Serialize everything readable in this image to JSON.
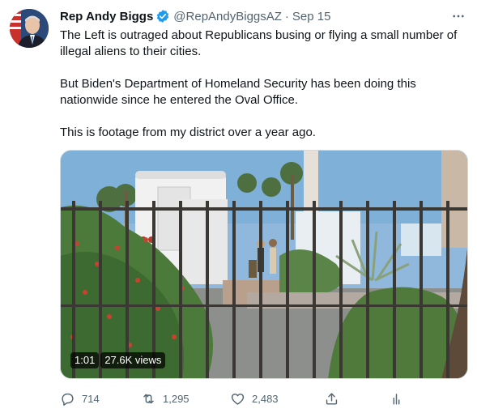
{
  "tweet": {
    "display_name": "Rep Andy Biggs",
    "verified": true,
    "handle": "@RepAndyBiggsAZ",
    "separator": "·",
    "date": "Sep 15",
    "text": [
      "The Left is outraged about Republicans busing or flying a small number of illegal aliens to their cities.",
      "But Biden's Department of Homeland Security has been doing this nationwide since he entered the Oval Office.",
      "This is footage from my district over a year ago."
    ],
    "media": {
      "duration": "1:01",
      "views": "27.6K views"
    },
    "actions": {
      "replies": "714",
      "retweets": "1,295",
      "likes": "2,483"
    }
  },
  "icons": {
    "more": "more-icon",
    "verified": "verified-badge-icon",
    "reply": "reply-icon",
    "retweet": "retweet-icon",
    "like": "heart-icon",
    "share": "share-icon",
    "analytics": "analytics-icon"
  },
  "colors": {
    "verified": "#1d9bf0",
    "secondary_text": "#536471",
    "primary_text": "#0f1419"
  }
}
